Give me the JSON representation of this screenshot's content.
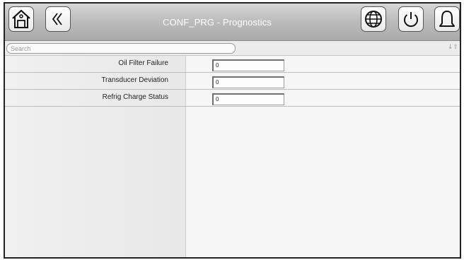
{
  "header": {
    "title": "CONF_PRG - Prognostics"
  },
  "search": {
    "placeholder": "Search"
  },
  "icons": {
    "home": "home-icon",
    "back": "double-chevron-left-icon",
    "language": "globe-icon",
    "power": "power-icon",
    "alarm": "bell-icon",
    "sort": "sort-icon"
  },
  "rows": [
    {
      "label": "Oil Filter Failure",
      "value": "0"
    },
    {
      "label": "Transducer Deviation",
      "value": "0"
    },
    {
      "label": "Refrig Charge Status",
      "value": "0"
    }
  ]
}
